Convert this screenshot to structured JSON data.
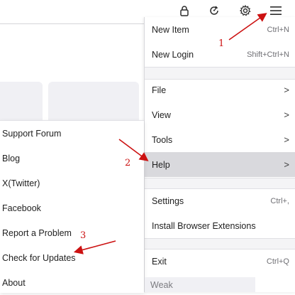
{
  "toolbar": {
    "icons": [
      "lock-icon",
      "sync-icon",
      "gear-icon",
      "hamburger-menu-icon"
    ]
  },
  "main_menu": {
    "items": [
      {
        "label": "New Item",
        "shortcut": "Ctrl+N"
      },
      {
        "label": "New Login",
        "shortcut": "Shift+Ctrl+N"
      },
      {
        "label": "File",
        "arrow": ">"
      },
      {
        "label": "View",
        "arrow": ">"
      },
      {
        "label": "Tools",
        "arrow": ">"
      },
      {
        "label": "Help",
        "arrow": ">"
      },
      {
        "label": "Settings",
        "shortcut": "Ctrl+,"
      },
      {
        "label": "Install Browser Extensions"
      },
      {
        "label": "Exit",
        "shortcut": "Ctrl+Q"
      }
    ]
  },
  "help_submenu": {
    "items": [
      "Support Forum",
      "Blog",
      "X(Twitter)",
      "Facebook",
      "Report a Problem",
      "Check for Updates",
      "About"
    ]
  },
  "strength_label": "Weak",
  "annotations": {
    "step1": "1",
    "step2": "2",
    "step3": "3",
    "color": "#cc1111"
  }
}
